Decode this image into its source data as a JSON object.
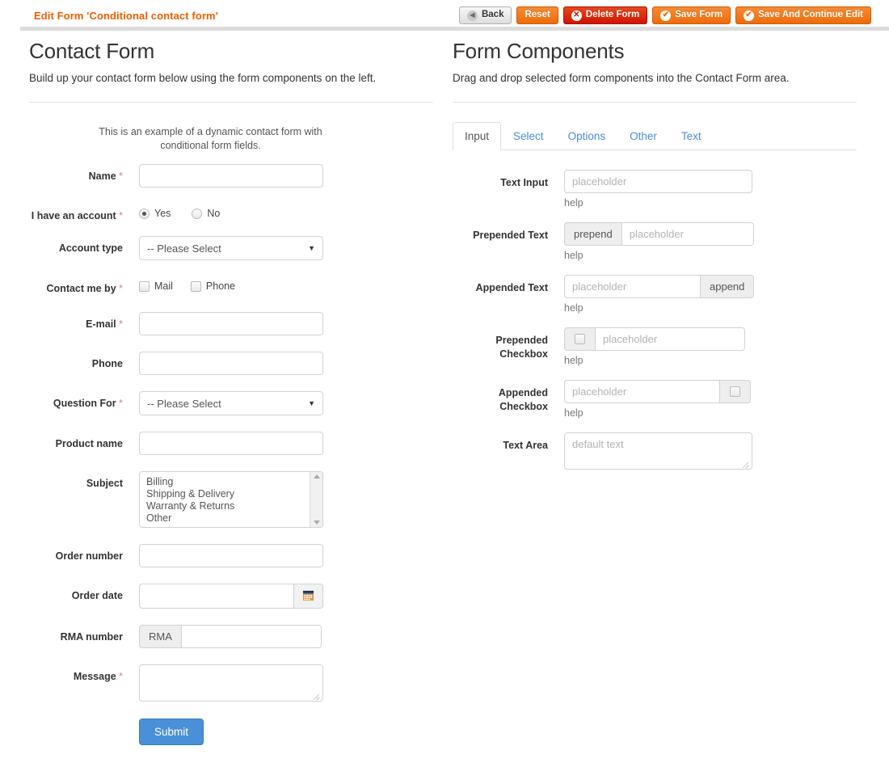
{
  "header": {
    "title": "Edit Form 'Conditional contact form'",
    "buttons": [
      {
        "label": "Back",
        "icon": "back-arrow-icon",
        "style": "back"
      },
      {
        "label": "Reset",
        "icon": "",
        "style": "orange"
      },
      {
        "label": "Delete Form",
        "icon": "delete-x-icon",
        "style": "red"
      },
      {
        "label": "Save Form",
        "icon": "check-circle-icon",
        "style": "orange"
      },
      {
        "label": "Save And Continue Edit",
        "icon": "check-circle-icon",
        "style": "orange"
      }
    ]
  },
  "colors": {
    "brand_orange": "#eb5e00",
    "danger_red": "#cf1200",
    "link_blue": "#4a8bd4",
    "submit_blue": "#4a90d9",
    "required_star": "#f07878"
  },
  "contact_form": {
    "heading": "Contact Form",
    "subheading": "Build up your contact form below using the form components on the left.",
    "intro": "This is an example of a dynamic contact form with conditional form fields.",
    "fields": {
      "name": {
        "label": "Name",
        "required": true,
        "value": ""
      },
      "have_account": {
        "label": "I have an account",
        "required": true,
        "options": [
          {
            "label": "Yes",
            "selected": true
          },
          {
            "label": "No",
            "selected": false
          }
        ]
      },
      "account_type": {
        "label": "Account type",
        "required": false,
        "selected": "-- Please Select"
      },
      "contact_me_by": {
        "label": "Contact me by",
        "required": true,
        "options": [
          {
            "label": "Mail",
            "checked": false
          },
          {
            "label": "Phone",
            "checked": false
          }
        ]
      },
      "email": {
        "label": "E-mail",
        "required": true,
        "value": ""
      },
      "phone": {
        "label": "Phone",
        "required": false,
        "value": ""
      },
      "question_for": {
        "label": "Question For",
        "required": true,
        "selected": "-- Please Select"
      },
      "product_name": {
        "label": "Product name",
        "required": false,
        "value": ""
      },
      "subject": {
        "label": "Subject",
        "required": false,
        "options": [
          "Billing",
          "Shipping & Delivery",
          "Warranty & Returns",
          "Other"
        ]
      },
      "order_number": {
        "label": "Order number",
        "required": false,
        "value": ""
      },
      "order_date": {
        "label": "Order date",
        "required": false,
        "value": "",
        "icon": "calendar-icon"
      },
      "rma_number": {
        "label": "RMA number",
        "required": false,
        "value": "",
        "prefix": "RMA"
      },
      "message": {
        "label": "Message",
        "required": true,
        "value": ""
      }
    },
    "submit_label": "Submit"
  },
  "form_components": {
    "heading": "Form Components",
    "subheading": "Drag and drop selected form components into the Contact Form area.",
    "tabs": [
      {
        "label": "Input",
        "active": true
      },
      {
        "label": "Select",
        "active": false
      },
      {
        "label": "Options",
        "active": false
      },
      {
        "label": "Other",
        "active": false
      },
      {
        "label": "Text",
        "active": false
      }
    ],
    "items": {
      "text_input": {
        "label": "Text Input",
        "placeholder": "placeholder",
        "help": "help"
      },
      "prepended_text": {
        "label": "Prepended Text",
        "addon": "prepend",
        "placeholder": "placeholder",
        "help": "help"
      },
      "appended_text": {
        "label": "Appended Text",
        "addon": "append",
        "placeholder": "placeholder",
        "help": "help"
      },
      "prepended_checkbox": {
        "label": "Prepended Checkbox",
        "checked": false,
        "placeholder": "placeholder",
        "help": "help"
      },
      "appended_checkbox": {
        "label": "Appended Checkbox",
        "checked": false,
        "placeholder": "placeholder",
        "help": "help"
      },
      "text_area": {
        "label": "Text Area",
        "placeholder": "default text"
      }
    }
  }
}
